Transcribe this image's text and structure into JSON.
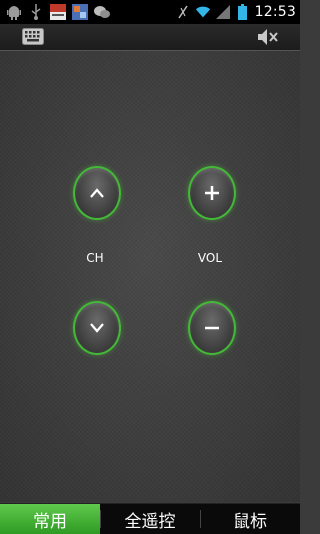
{
  "status_bar": {
    "time": "12:53",
    "left_icons": [
      "android-debug-icon",
      "usb-icon",
      "app-notification-icon",
      "photo-app-icon",
      "chat-icon"
    ],
    "right_icons": [
      "vibrate-icon",
      "wifi-icon",
      "signal-icon",
      "battery-icon"
    ]
  },
  "toolbar": {
    "left_icon": "keyboard-icon",
    "right_icon": "mute-icon"
  },
  "remote": {
    "ch_label": "CH",
    "vol_label": "VOL",
    "accent_color": "#44b838"
  },
  "tabs": [
    {
      "label": "常用",
      "active": true
    },
    {
      "label": "全遥控",
      "active": false
    },
    {
      "label": "鼠标",
      "active": false
    }
  ]
}
